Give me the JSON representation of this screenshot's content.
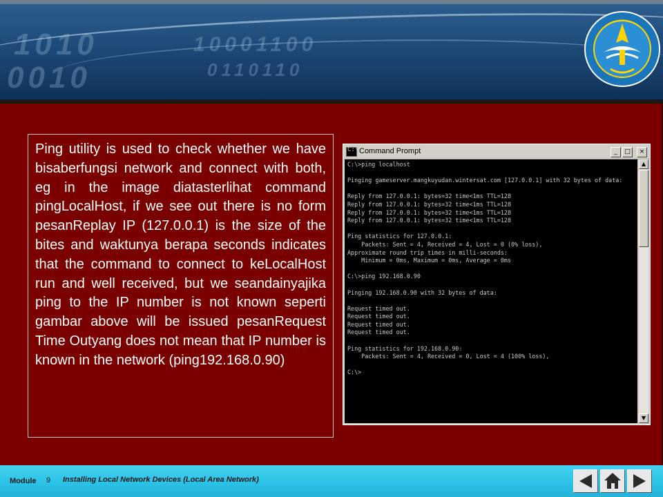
{
  "slide": {
    "body_text": "Ping utility is used to check whether we have bisaberfungsi network and connect with both, eg in the image diatasterlihat command pingLocalHost, if we see out there is no form pesanReplay IP (127.0.0.1) is the size of the bites and waktunya berapa seconds indicates that the command to connect to keLocalHost run and well received, but we seandainyajika ping to the IP number is not known seperti gambar above will be issued pesanRequest Time Outyang does not mean that IP number is known in the network (ping192.168.0.90)"
  },
  "command_prompt": {
    "window_title": "Command Prompt",
    "console_text": "C:\\>ping localhost\n\nPinging gameserver.mangkuyudan.wintersat.com [127.0.0.1] with 32 bytes of data:\n\nReply from 127.0.0.1: bytes=32 time<1ms TTL=128\nReply from 127.0.0.1: bytes=32 time<1ms TTL=128\nReply from 127.0.0.1: bytes=32 time<1ms TTL=128\nReply from 127.0.0.1: bytes=32 time<1ms TTL=128\n\nPing statistics for 127.0.0.1:\n    Packets: Sent = 4, Received = 4, Lost = 0 (0% loss),\nApproximate round trip times in milli-seconds:\n    Minimum = 0ms, Maximum = 0ms, Average = 0ms\n\nC:\\>ping 192.168.0.90\n\nPinging 192.168.0.90 with 32 bytes of data:\n\nRequest timed out.\nRequest timed out.\nRequest timed out.\nRequest timed out.\n\nPing statistics for 192.168.0.90:\n    Packets: Sent = 4, Received = 0, Lost = 4 (100% loss),\n\nC:\\>"
  },
  "footer": {
    "module_label": "Module",
    "module_number": "9",
    "course_title": "Installing Local Network Devices (Local Area Network)"
  },
  "navigation": {
    "icons": [
      "previous-arrow-icon",
      "home-icon",
      "next-arrow-icon"
    ]
  },
  "colors": {
    "content_background": "#7a0000",
    "footer_background": "#2ac0e6",
    "banner_background": "#1d4a78"
  }
}
